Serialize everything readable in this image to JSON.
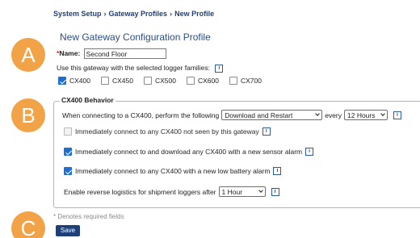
{
  "breadcrumb": {
    "items": [
      "System Setup",
      "Gateway Profiles",
      "New Profile"
    ],
    "separator": "›"
  },
  "page_title": "New Gateway Configuration Profile",
  "callouts": [
    "A",
    "B",
    "C"
  ],
  "name_field": {
    "required_mark": "*",
    "label": "Name:",
    "value": "Second Floor"
  },
  "families": {
    "label": "Use this gateway with the selected logger families:",
    "info_icon_glyph": "i",
    "items": [
      {
        "label": "CX400",
        "checked": true
      },
      {
        "label": "CX450",
        "checked": false
      },
      {
        "label": "CX500",
        "checked": false
      },
      {
        "label": "CX600",
        "checked": false
      },
      {
        "label": "CX700",
        "checked": false
      }
    ]
  },
  "behavior": {
    "legend": "CX400 Behavior",
    "connect_prefix": "When connecting to a CX400, perform the following",
    "action_select": "Download and Restart",
    "every_label": "every",
    "interval_select": "12 Hours",
    "options": [
      {
        "label": "Immediately connect to any CX400 not seen by this gateway",
        "checked": false,
        "disabled": true
      },
      {
        "label": "Immediately connect to and download any CX400 with a new sensor alarm",
        "checked": true,
        "disabled": false
      },
      {
        "label": "Immediately connect to any CX400 with a new low battery alarm",
        "checked": true,
        "disabled": false
      }
    ],
    "reverse_label": "Enable reverse logistics for shipment loggers after",
    "reverse_select": "1 Hour"
  },
  "required_note": "* Denotes required fields",
  "save_label": "Save",
  "colors": {
    "accent": "#1f3f78",
    "callout": "#f3a347",
    "checkbox": "#1f6fd1"
  },
  "icons": {
    "info": "info-icon",
    "dropdown": "chevron-down-icon",
    "check": "checkmark-icon"
  }
}
